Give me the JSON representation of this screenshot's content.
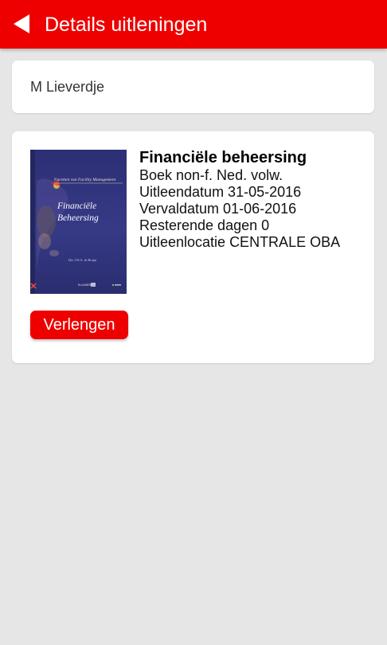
{
  "colors": {
    "accent": "#ee0000",
    "background": "#e6e6e6",
    "card": "#ffffff"
  },
  "header": {
    "back_icon": "back-arrow-icon",
    "title": "Details uitleningen"
  },
  "user": {
    "name": "M Lieverdje"
  },
  "loan": {
    "cover": {
      "series": "Facetten van Facility Management",
      "title_line1": "Financiële",
      "title_line2": "Beheersing",
      "author": "Drs J.W.A. de Bruijn",
      "publisher": "KLUWER"
    },
    "title": "Financiële beheersing",
    "type": "Boek non-f. Ned. volw.",
    "loan_date": "Uitleendatum 31-05-2016",
    "due_date": "Vervaldatum 01-06-2016",
    "days_remaining": "Resterende dagen 0",
    "location": "Uitleenlocatie CENTRALE OBA",
    "renew_label": "Verlengen"
  }
}
